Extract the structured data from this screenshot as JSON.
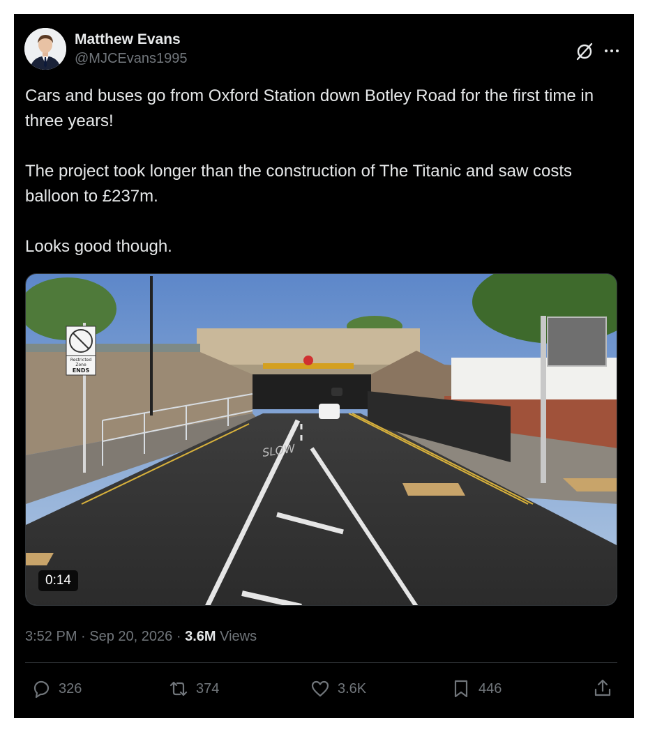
{
  "author": {
    "display_name": "Matthew Evans",
    "handle": "@MJCEvans1995"
  },
  "tweet": {
    "paragraphs": [
      "Cars and buses go from Oxford Station down Botley Road for the first time in three years!",
      "The project took longer than the construction of The Titanic and saw costs balloon to £237m.",
      "Looks good though."
    ]
  },
  "media": {
    "type": "video",
    "duration": "0:14",
    "scene_signs": {
      "sign_line1": "Restricted",
      "sign_line2": "Zone",
      "sign_line3": "ENDS",
      "road_marking": "SLOW"
    }
  },
  "meta": {
    "time": "3:52 PM",
    "separator": "·",
    "date": "Sep 20, 2026",
    "views_count": "3.6M",
    "views_label": "Views"
  },
  "actions": {
    "replies": "326",
    "reposts": "374",
    "likes": "3.6K",
    "bookmarks": "446"
  },
  "icons": [
    "grok-icon",
    "more-icon",
    "reply-icon",
    "repost-icon",
    "like-icon",
    "bookmark-icon",
    "share-icon"
  ],
  "colors": {
    "background": "#000000",
    "text_primary": "#e7e9ea",
    "text_secondary": "#71767b",
    "divider": "#2f3336"
  }
}
